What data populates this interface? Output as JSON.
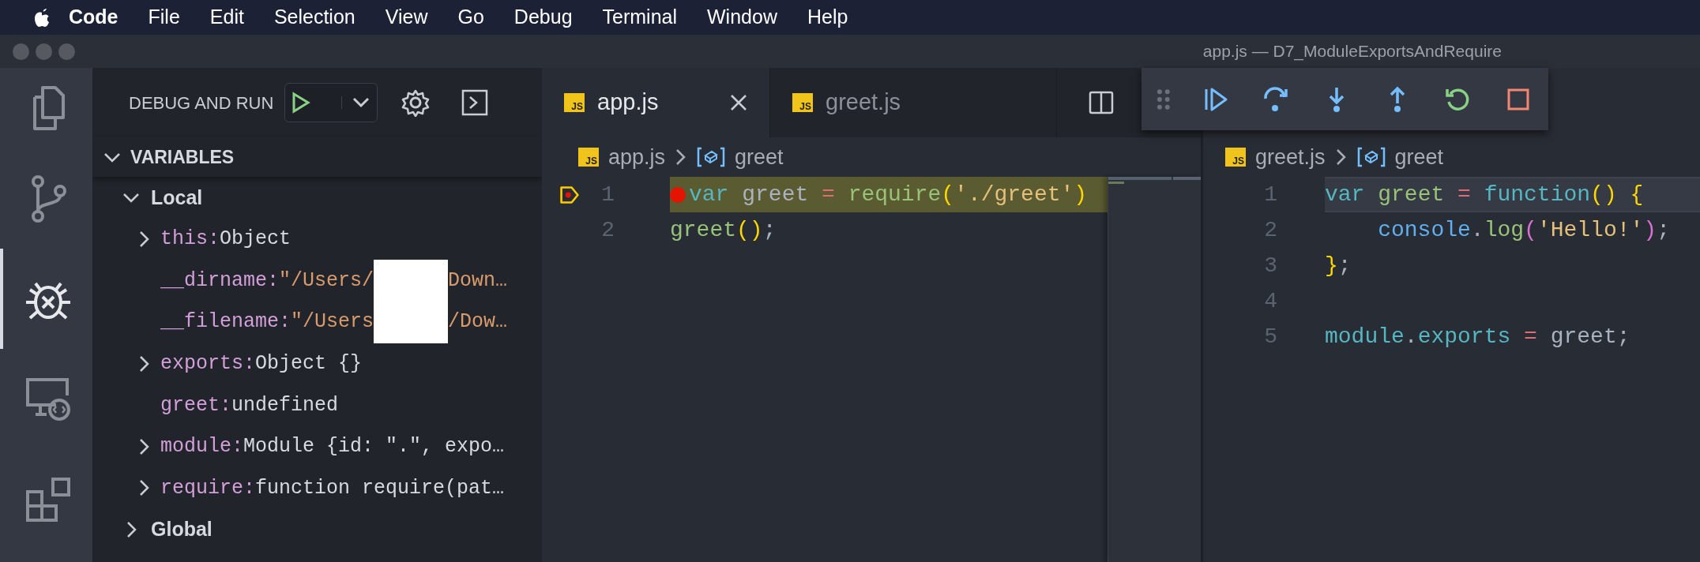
{
  "menu_bar": {
    "items": [
      {
        "label": "Code",
        "bold": true
      },
      {
        "label": "File",
        "bold": false
      },
      {
        "label": "Edit",
        "bold": false
      },
      {
        "label": "Selection",
        "bold": false
      },
      {
        "label": "View",
        "bold": false
      },
      {
        "label": "Go",
        "bold": false
      },
      {
        "label": "Debug",
        "bold": false
      },
      {
        "label": "Terminal",
        "bold": false
      },
      {
        "label": "Window",
        "bold": false
      },
      {
        "label": "Help",
        "bold": false
      }
    ]
  },
  "window": {
    "title": "app.js — D7_ModuleExportsAndRequire"
  },
  "activity_bar": {
    "items": [
      {
        "kind": "explorer",
        "selected": false
      },
      {
        "kind": "source-control",
        "selected": false
      },
      {
        "kind": "debug",
        "selected": true
      },
      {
        "kind": "remote",
        "selected": false
      },
      {
        "kind": "extensions",
        "selected": false
      }
    ]
  },
  "debug_panel": {
    "title": "DEBUG AND RUN"
  },
  "variables": {
    "title": "VARIABLES",
    "expanded": true,
    "scopes": [
      {
        "name": "Local",
        "expanded": true,
        "children": [
          {
            "name": "this:",
            "value": "Object",
            "kind": "object",
            "expandable": true
          },
          {
            "name": "__dirname:",
            "value": "\"/Users/",
            "value_after": "Down…",
            "redacted": true,
            "kind": "string",
            "expandable": false
          },
          {
            "name": "__filename:",
            "value": "\"/Users",
            "value_after": "/Dow…",
            "redacted": true,
            "kind": "string",
            "expandable": false
          },
          {
            "name": "exports:",
            "value": "Object {}",
            "kind": "object",
            "expandable": true
          },
          {
            "name": "greet:",
            "value": "undefined",
            "kind": "object",
            "expandable": false
          },
          {
            "name": "module:",
            "value": "Module {id: \".\", expo…",
            "kind": "object",
            "expandable": true
          },
          {
            "name": "require:",
            "value": "function require(pat…",
            "kind": "object",
            "expandable": true
          }
        ]
      },
      {
        "name": "Global",
        "expanded": false
      }
    ]
  },
  "tabs": [
    {
      "label": "app.js",
      "icon_label": "JS",
      "selected": true
    },
    {
      "label": "greet.js",
      "icon_label": "JS",
      "selected": false
    }
  ],
  "debug_toolbar": {
    "buttons": [
      {
        "kind": "continue"
      },
      {
        "kind": "step-over"
      },
      {
        "kind": "step-into"
      },
      {
        "kind": "step-out"
      },
      {
        "kind": "restart"
      },
      {
        "kind": "stop"
      }
    ]
  },
  "editors": [
    {
      "breadcrumb": {
        "icon_label": "JS",
        "file": "app.js",
        "symbol": "greet"
      },
      "minimap": true,
      "lines": [
        {
          "number": "1",
          "paused": true,
          "breakpoint": true,
          "current": false,
          "tokens": [
            {
              "text": "var",
              "color": "#56b6c2"
            },
            {
              "text": " greet ",
              "color": "#abb2bf"
            },
            {
              "text": "=",
              "color": "#e06c75"
            },
            {
              "text": " require",
              "color": "#98c379"
            },
            {
              "text": "(",
              "color": "#ffd700"
            },
            {
              "text": "'./greet'",
              "color": "#e5c07b"
            },
            {
              "text": ")",
              "color": "#ffd700"
            }
          ]
        },
        {
          "number": "2",
          "paused": false,
          "breakpoint": false,
          "current": false,
          "tokens": [
            {
              "text": "greet",
              "color": "#98c379"
            },
            {
              "text": "()",
              "color": "#ffd700"
            },
            {
              "text": ";",
              "color": "#abb2bf"
            }
          ]
        }
      ]
    },
    {
      "breadcrumb": {
        "icon_label": "JS",
        "file": "greet.js",
        "symbol": "greet"
      },
      "minimap": false,
      "lines": [
        {
          "number": "1",
          "paused": false,
          "breakpoint": false,
          "current": true,
          "tokens": [
            {
              "text": "var",
              "color": "#56b6c2"
            },
            {
              "text": " greet",
              "color": "#98c379"
            },
            {
              "text": " =",
              "color": "#e06c75"
            },
            {
              "text": " function",
              "color": "#56b6c2"
            },
            {
              "text": "() ",
              "color": "#ffd700"
            },
            {
              "text": "{",
              "color": "#ffd700"
            }
          ]
        },
        {
          "number": "2",
          "paused": false,
          "breakpoint": false,
          "current": false,
          "tokens": [
            {
              "text": "    console",
              "color": "#61afef"
            },
            {
              "text": ".",
              "color": "#abb2bf"
            },
            {
              "text": "log",
              "color": "#98c379"
            },
            {
              "text": "(",
              "color": "#da70d6"
            },
            {
              "text": "'Hello!'",
              "color": "#e5c07b"
            },
            {
              "text": ")",
              "color": "#da70d6"
            },
            {
              "text": ";",
              "color": "#abb2bf"
            }
          ]
        },
        {
          "number": "3",
          "paused": false,
          "breakpoint": false,
          "current": false,
          "tokens": [
            {
              "text": "}",
              "color": "#ffd700"
            },
            {
              "text": ";",
              "color": "#abb2bf"
            }
          ]
        },
        {
          "number": "4",
          "paused": false,
          "breakpoint": false,
          "current": false
        },
        {
          "number": "5",
          "paused": false,
          "breakpoint": false,
          "current": false,
          "tokens": [
            {
              "text": "module",
              "color": "#56b6c2"
            },
            {
              "text": ".",
              "color": "#abb2bf"
            },
            {
              "text": "exports",
              "color": "#56b6c2"
            },
            {
              "text": " =",
              "color": "#e06c75"
            },
            {
              "text": " greet;",
              "color": "#abb2bf"
            }
          ]
        }
      ]
    }
  ]
}
